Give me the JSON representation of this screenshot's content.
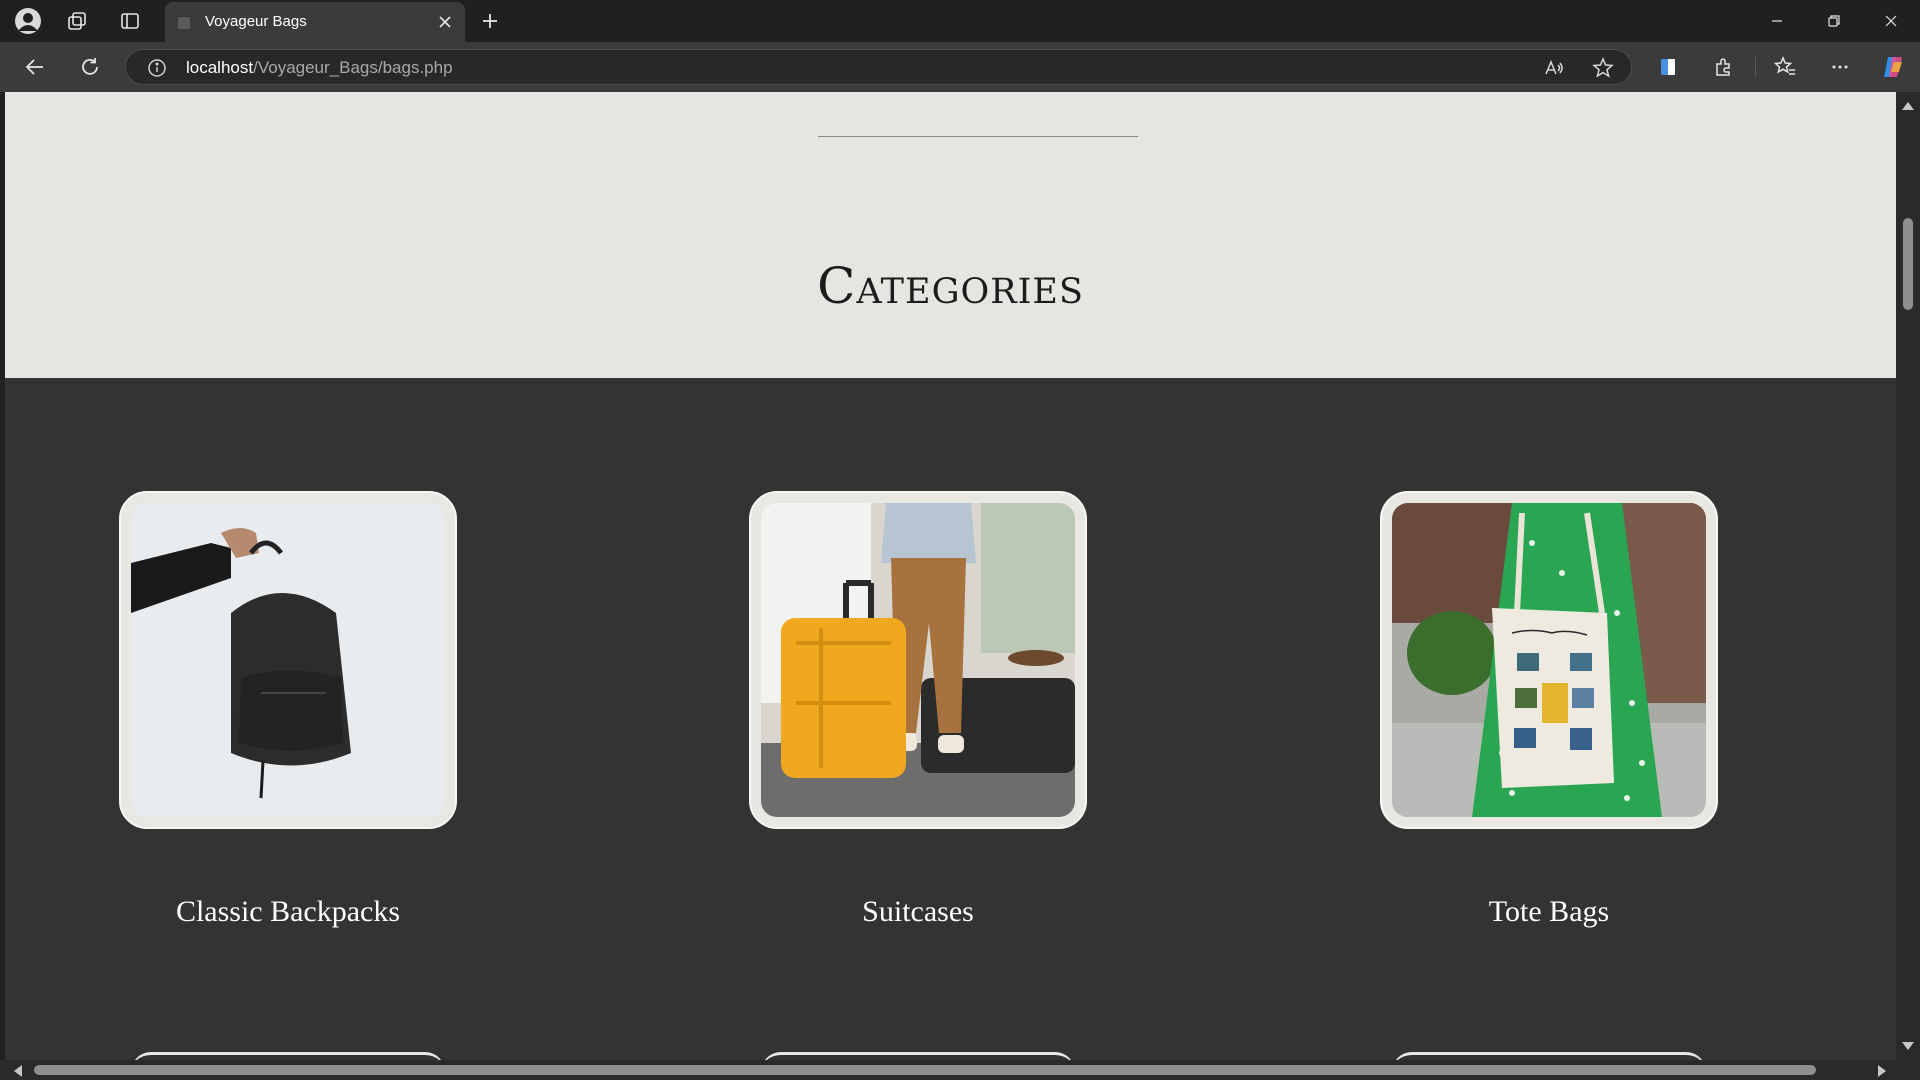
{
  "browser": {
    "tab": {
      "title": "Voyageur Bags",
      "favicon": "page-favicon-icon",
      "close_icon": "close-tab-icon"
    },
    "new_tab_icon": "plus-icon",
    "left_icons": [
      "profile-avatar-icon",
      "collections-icon",
      "vertical-tabs-icon"
    ],
    "window_controls": [
      "minimize-icon",
      "restore-icon",
      "close-window-icon"
    ],
    "toolbar": {
      "back_icon": "back-arrow-icon",
      "reload_icon": "reload-icon",
      "address": {
        "info_icon": "site-info-icon",
        "host": "localhost",
        "path": "/Voyageur_Bags/bags.php"
      },
      "omnibox_icons": [
        "read-aloud-icon",
        "favorite-star-icon"
      ],
      "right_icons": [
        "split-screen-icon",
        "extensions-icon",
        "favorites-icon",
        "more-menu-icon",
        "copilot-icon"
      ]
    }
  },
  "page": {
    "section_title": "Categories",
    "categories": [
      {
        "name": "Classic Backpacks",
        "image": "black-backpack-photo"
      },
      {
        "name": "Suitcases",
        "image": "yellow-suitcase-photo"
      },
      {
        "name": "Tote Bags",
        "image": "van-gogh-tote-photo"
      }
    ]
  },
  "colors": {
    "chrome_dark": "#202020",
    "chrome_toolbar": "#3b3b3b",
    "hero_bg": "#e6e5e1",
    "content_bg": "#333333",
    "card_frame": "#e9e7e2",
    "label_text": "#ffffff"
  }
}
